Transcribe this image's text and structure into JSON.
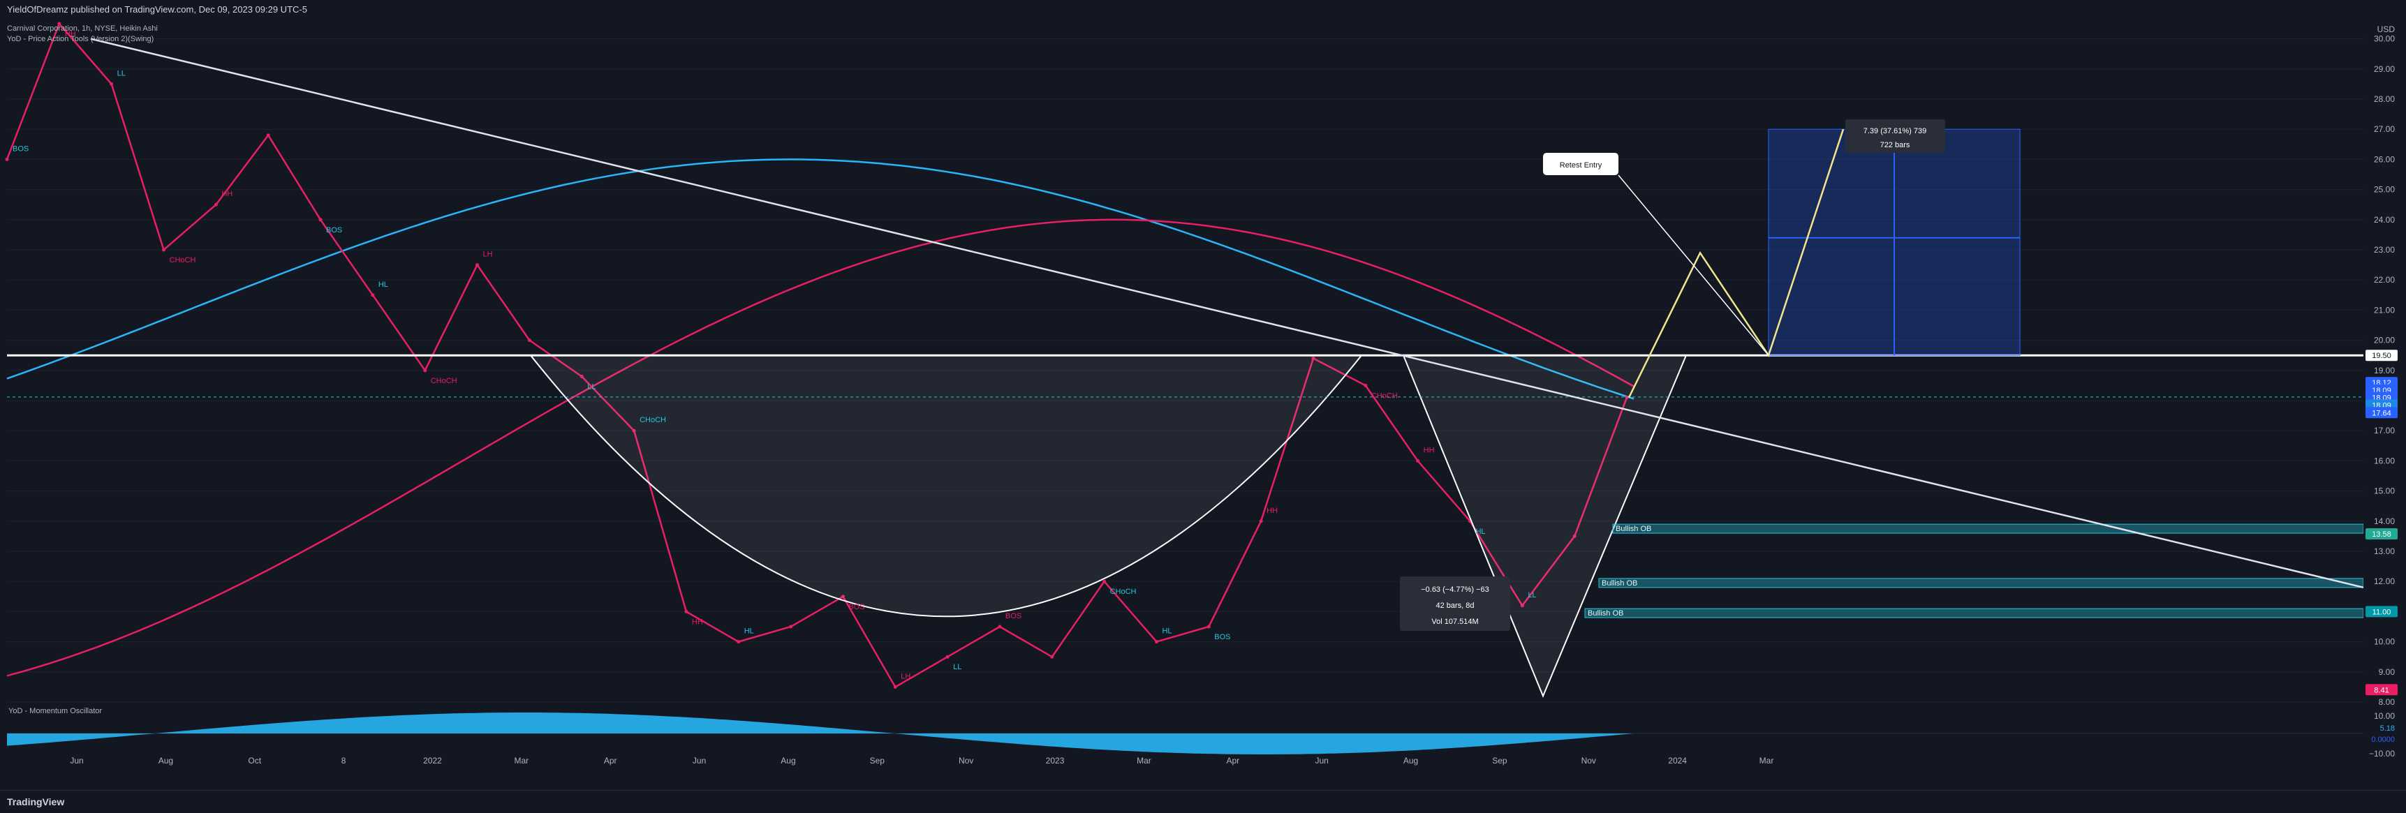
{
  "header": {
    "publisher_line": "YieldOfDreamz published on TradingView.com, Dec 09, 2023 09:29 UTC-5",
    "symbol_line": "Carnival Corporation, 1h, NYSE, Heikin Ashi",
    "indicator_line": "YoD - Price Action Tools (Version 2)(Swing)"
  },
  "footer": {
    "brand": "TradingView"
  },
  "oscillator": {
    "title": "YoD - Momentum Oscillator",
    "right_labels": [
      "5.18",
      "0.0000"
    ]
  },
  "price_axis": {
    "currency": "USD",
    "ticks": [
      "30.00",
      "29.00",
      "28.00",
      "27.00",
      "26.00",
      "25.00",
      "24.00",
      "23.00",
      "22.00",
      "21.00",
      "20.00",
      "19.00",
      "17.00",
      "16.00",
      "15.00",
      "14.00",
      "13.00",
      "12.00",
      "11.00",
      "10.00",
      "9.00",
      "8.00"
    ],
    "osc_ticks": [
      "10.00",
      "−10.00"
    ],
    "price_labels": [
      {
        "text": "19.50",
        "color": "#ffffff",
        "fg": "#131722"
      },
      {
        "text": "18.12",
        "color": "#2962ff",
        "fg": "#ffffff"
      },
      {
        "text": "18.09",
        "color": "#2962ff",
        "fg": "#ffffff"
      },
      {
        "text": "18.09",
        "color": "#2962ff",
        "fg": "#ffffff"
      },
      {
        "text": "18.09",
        "color": "#1e88e5",
        "fg": "#ffffff"
      },
      {
        "text": "17.64",
        "color": "#2962ff",
        "fg": "#ffffff"
      },
      {
        "text": "13.58",
        "color": "#22ab94",
        "fg": "#ffffff"
      },
      {
        "text": "11.00",
        "color": "#0097a7",
        "fg": "#ffffff"
      },
      {
        "text": "8.41",
        "color": "#e91e63",
        "fg": "#ffffff"
      }
    ]
  },
  "time_axis": {
    "labels": [
      "Jun",
      "Aug",
      "Oct",
      "8",
      "2022",
      "Mar",
      "Apr",
      "Jun",
      "Aug",
      "Sep",
      "Nov",
      "2023",
      "Mar",
      "Apr",
      "Jun",
      "Aug",
      "Sep",
      "Nov",
      "2024",
      "Mar"
    ]
  },
  "annotations": {
    "retest_entry": "Retest Entry",
    "measure_top_line1": "7.39 (37.61%) 739",
    "measure_top_line2": "722 bars",
    "measure_mid_line1": "−0.63 (−4.77%) −63",
    "measure_mid_line2": "42 bars, 8d",
    "measure_mid_line3": "Vol 107.514M",
    "ob_labels": [
      "Bullish OB",
      "Bullish OB",
      "Bullish OB"
    ],
    "structure_labels": [
      {
        "t": "BOS",
        "c": "#26c6da"
      },
      {
        "t": "HH",
        "c": "#e91e63"
      },
      {
        "t": "LL",
        "c": "#26c6da"
      },
      {
        "t": "CHoCH",
        "c": "#e91e63"
      },
      {
        "t": "HH",
        "c": "#e91e63"
      },
      {
        "t": "BOS",
        "c": "#26c6da"
      },
      {
        "t": "HL",
        "c": "#26c6da"
      },
      {
        "t": "CHoCH",
        "c": "#e91e63"
      },
      {
        "t": "LH",
        "c": "#e91e63"
      },
      {
        "t": "LL",
        "c": "#26c6da"
      },
      {
        "t": "CHoCH",
        "c": "#26c6da"
      },
      {
        "t": "HH",
        "c": "#e91e63"
      },
      {
        "t": "HL",
        "c": "#26c6da"
      },
      {
        "t": "BOS",
        "c": "#e91e63"
      },
      {
        "t": "LH",
        "c": "#e91e63"
      },
      {
        "t": "LL",
        "c": "#26c6da"
      },
      {
        "t": "BOS",
        "c": "#e91e63"
      },
      {
        "t": "CHoCH",
        "c": "#26c6da"
      },
      {
        "t": "HL",
        "c": "#26c6da"
      },
      {
        "t": "BOS",
        "c": "#26c6da"
      },
      {
        "t": "HH",
        "c": "#e91e63"
      },
      {
        "t": "CHoCH",
        "c": "#e91e63"
      },
      {
        "t": "HH",
        "c": "#e91e63"
      },
      {
        "t": "HL",
        "c": "#26c6da"
      },
      {
        "t": "LL",
        "c": "#26c6da"
      }
    ]
  },
  "chart_data": {
    "type": "line",
    "title": "Carnival Corporation, 1h, NYSE, Heikin Ashi",
    "xlabel": "",
    "ylabel": "",
    "ylim": [
      8.0,
      30.5
    ],
    "x": [
      "2021-05",
      "2021-06",
      "2021-07",
      "2021-08",
      "2021-09",
      "2021-10",
      "2021-11",
      "2021-12",
      "2022-01",
      "2022-02",
      "2022-03",
      "2022-04",
      "2022-05",
      "2022-06",
      "2022-07",
      "2022-08",
      "2022-09",
      "2022-10",
      "2022-11",
      "2022-12",
      "2023-01",
      "2023-02",
      "2023-03",
      "2023-04",
      "2023-05",
      "2023-06",
      "2023-07",
      "2023-08",
      "2023-09",
      "2023-10",
      "2023-11",
      "2023-12"
    ],
    "series": [
      {
        "values": [
          26.0,
          30.5,
          28.5,
          23.0,
          24.5,
          26.8,
          24.0,
          21.5,
          19.0,
          22.5,
          20.0,
          18.8,
          17.0,
          11.0,
          10.0,
          10.5,
          11.5,
          8.5,
          9.5,
          10.5,
          9.5,
          12.0,
          10.0,
          10.5,
          14.0,
          19.4,
          18.5,
          16.0,
          14.0,
          11.2,
          13.5,
          18.1
        ],
        "color": "#e91e63"
      }
    ],
    "levels": [
      {
        "price": 19.5,
        "color": "#ffffff"
      },
      {
        "price": 18.12,
        "color": "#26c6da"
      }
    ],
    "order_blocks": [
      {
        "top": 13.9,
        "bottom": 13.6,
        "label": "Bullish OB"
      },
      {
        "top": 12.1,
        "bottom": 11.8,
        "label": "Bullish OB"
      },
      {
        "top": 11.1,
        "bottom": 10.8,
        "label": "Bullish OB"
      }
    ],
    "target_box": {
      "from": 19.5,
      "to": 27.0,
      "change": "7.39 (37.61%) 739",
      "bars": "722 bars"
    },
    "grid": true,
    "legend": "none"
  }
}
